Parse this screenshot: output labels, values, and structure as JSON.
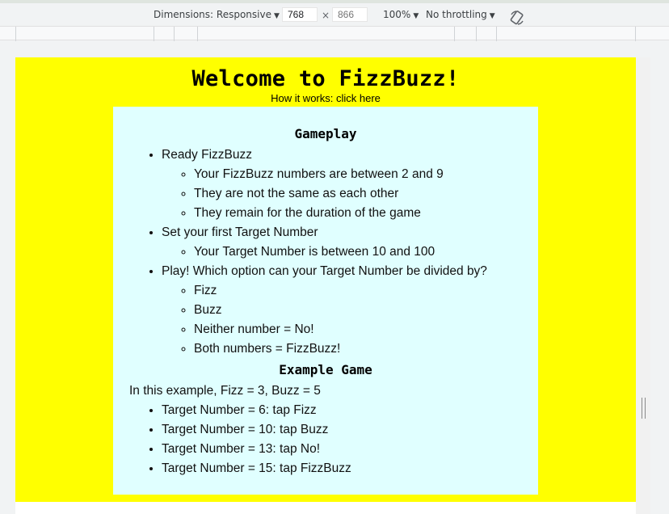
{
  "devtools": {
    "dimensions_label": "Dimensions: Responsive",
    "width_value": "768",
    "times": "×",
    "height_placeholder": "866",
    "zoom": "100%",
    "throttling": "No throttling"
  },
  "page": {
    "title": "Welcome to FizzBuzz!",
    "how_prefix": "How it works: ",
    "how_link": "click here",
    "gameplay": {
      "heading": "Gameplay",
      "steps": [
        {
          "label": "Ready FizzBuzz",
          "sub": [
            "Your FizzBuzz numbers are between 2 and 9",
            "They are not the same as each other",
            "They remain for the duration of the game"
          ]
        },
        {
          "label": "Set your first Target Number",
          "sub": [
            "Your Target Number is between 10 and 100"
          ]
        },
        {
          "label": "Play! Which option can your Target Number be divided by?",
          "sub": [
            "Fizz",
            "Buzz",
            "Neither number = No!",
            "Both numbers = FizzBuzz!"
          ]
        }
      ]
    },
    "example": {
      "heading": "Example Game",
      "intro": "In this example, Fizz = 3, Buzz = 5",
      "items": [
        "Target Number = 6: tap Fizz",
        "Target Number = 10: tap Buzz",
        "Target Number = 13: tap No!",
        "Target Number = 15: tap FizzBuzz"
      ]
    }
  }
}
